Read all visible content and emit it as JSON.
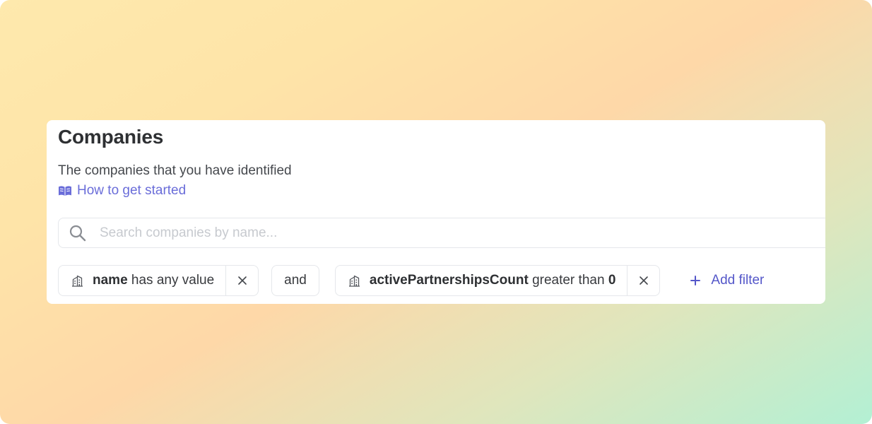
{
  "header": {
    "title": "Companies",
    "subtitle": "The companies that you have identified",
    "guide_link": "How to get started",
    "guide_icon": "book-open-icon"
  },
  "search": {
    "placeholder": "Search companies by name...",
    "value": "",
    "icon": "search-icon"
  },
  "filters": [
    {
      "icon": "building-icon",
      "field": "name",
      "operator": "has any value",
      "value": ""
    },
    {
      "icon": "building-icon",
      "field": "activePartnershipsCount",
      "operator": "greater than",
      "value": "0"
    }
  ],
  "conjunction": "and",
  "add_filter": {
    "label": "Add filter",
    "icon": "plus-icon"
  },
  "colors": {
    "accent": "#6a6dd9",
    "add_filter": "#5457c9",
    "title": "#2e3033"
  }
}
